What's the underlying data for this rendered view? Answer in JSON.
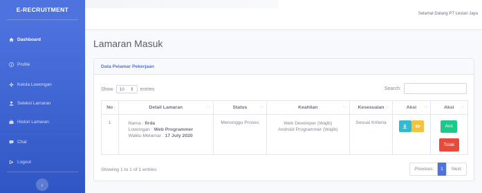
{
  "app": {
    "brand": "E-RECRUITMENT",
    "welcome": "Selamat Datang PT Lestari Jaya",
    "colors": {
      "primary": "#4e73df",
      "info": "#36b9cc",
      "warning": "#f6c23e",
      "success": "#1cc88a",
      "danger": "#e74a3b"
    }
  },
  "sidebar": {
    "items": [
      {
        "label": "Dashboard",
        "icon": "home-icon",
        "active": true
      },
      {
        "label": "Profile",
        "icon": "info-icon"
      },
      {
        "label": "Kelola Lowongan",
        "icon": "gear-icon"
      },
      {
        "label": "Seleksi Lamaran",
        "icon": "user-icon"
      },
      {
        "label": "Histori Lamaran",
        "icon": "briefcase-icon"
      },
      {
        "label": "Chat",
        "icon": "chat-icon"
      },
      {
        "label": "Logout",
        "icon": "logout-icon"
      }
    ],
    "toggle_glyph": "‹"
  },
  "page": {
    "title": "Lamaran Masuk"
  },
  "card": {
    "title": "Data Pelamar Pekerjaan",
    "show_label": "Show",
    "entries_value": "10",
    "entries_label": "entries",
    "search_label": "Search:",
    "columns": [
      "No",
      "Detail Lamaran",
      "Status",
      "Keahlian",
      "Kesesuaian",
      "Aksi",
      "Aksi"
    ],
    "sort_glyph": "↑↓",
    "rows": [
      {
        "no": "1",
        "nama_label": "Nama :",
        "nama": "firda",
        "lowongan_label": "Lowongan :",
        "lowongan": "Web Programmer",
        "waktu_label": "Waktu Melamar :",
        "waktu": "17 July 2020",
        "status": "Menunggu Proses",
        "keahlian": [
          "Web Developer (Wajib)",
          "Android Programmer (Wajib)"
        ],
        "kesesuaian": "Sesuai Kriteria",
        "acc_label": "Acc",
        "tolak_label": "Tolak"
      }
    ],
    "info": "Showing 1 to 1 of 1 entries",
    "pager": {
      "previous": "Previous",
      "current": "1",
      "next": "Next"
    }
  }
}
